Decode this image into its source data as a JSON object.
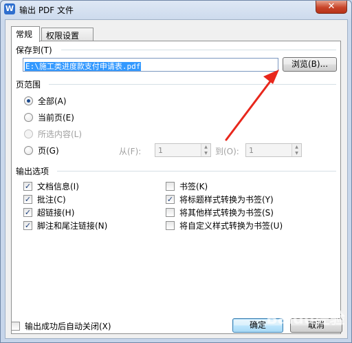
{
  "window": {
    "title": "输出 PDF 文件",
    "app_icon_letter": "W",
    "close_symbol": "✕"
  },
  "tabs": [
    {
      "label": "常规"
    },
    {
      "label": "权限设置"
    }
  ],
  "save_to": {
    "group_title": "保存到(T)",
    "path_value": "E:\\施工类进度款支付申请表.pdf",
    "browse_label": "浏览(B)..."
  },
  "page_range": {
    "group_title": "页范围",
    "options": [
      {
        "label": "全部(A)",
        "checked": true,
        "disabled": false
      },
      {
        "label": "当前页(E)",
        "checked": false,
        "disabled": false
      },
      {
        "label": "所选内容(L)",
        "checked": false,
        "disabled": true
      },
      {
        "label": "页(G)",
        "checked": false,
        "disabled": false
      }
    ],
    "from_label": "从(F):",
    "from_value": "1",
    "to_label": "到(O):",
    "to_value": "1"
  },
  "output_options": {
    "group_title": "输出选项",
    "left": [
      {
        "label": "文档信息(I)",
        "checked": true
      },
      {
        "label": "批注(C)",
        "checked": true
      },
      {
        "label": "超链接(H)",
        "checked": true
      },
      {
        "label": "脚注和尾注链接(N)",
        "checked": true
      }
    ],
    "right": [
      {
        "label": "书签(K)",
        "checked": false
      },
      {
        "label": "将标题样式转换为书签(Y)",
        "checked": true
      },
      {
        "label": "将其他样式转换为书签(S)",
        "checked": false
      },
      {
        "label": "将自定义样式转换为书签(U)",
        "checked": false
      }
    ]
  },
  "footer": {
    "auto_close_label": "输出成功后自动关闭(X)",
    "auto_close_checked": false,
    "ok_label": "确定",
    "cancel_label": "取消"
  },
  "colors": {
    "annotation_arrow": "#e8271c",
    "selection": "#3399ff"
  },
  "watermark_text": "Baidu经验"
}
